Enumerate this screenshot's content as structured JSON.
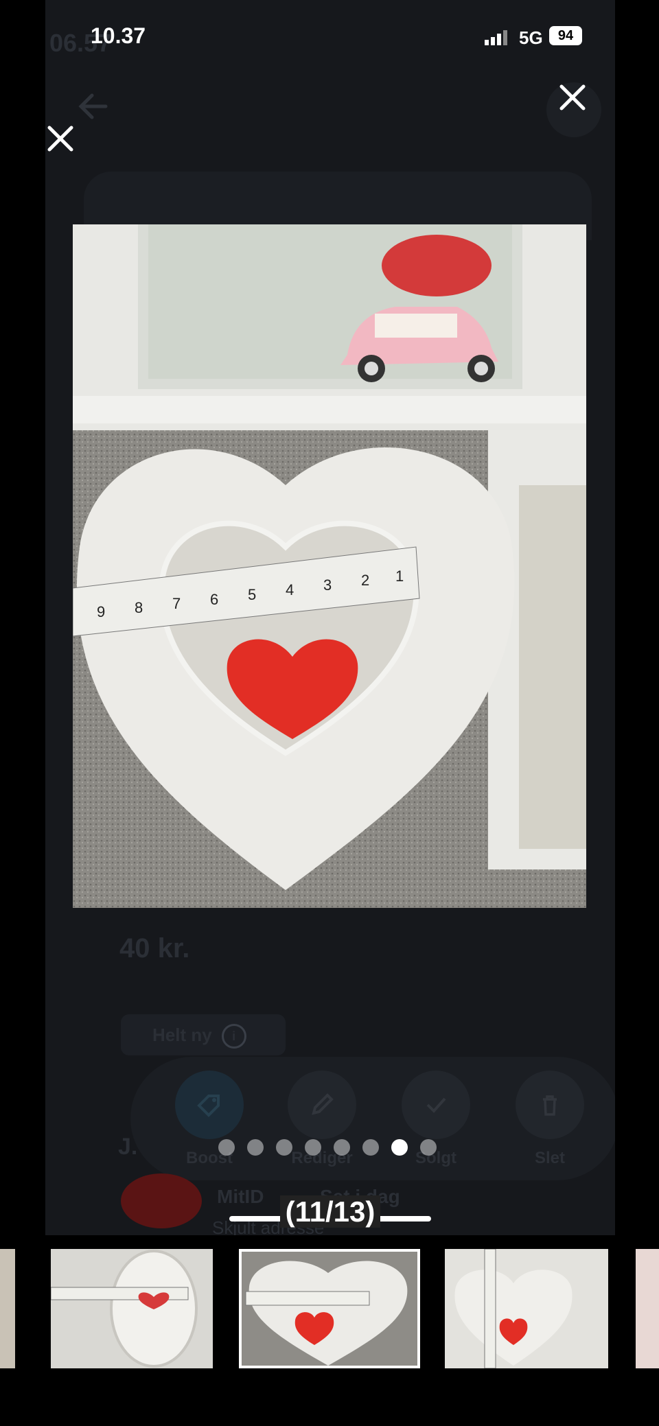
{
  "status_bar": {
    "time": "10.37",
    "network": "5G",
    "battery": "94"
  },
  "background_app": {
    "status_time": "06.57",
    "price": "40 kr.",
    "condition_chip": "Helt ny",
    "info_icon": "info-icon",
    "actions": [
      {
        "label": "Boost",
        "icon": "tag-icon"
      },
      {
        "label": "Rediger",
        "icon": "pencil-icon"
      },
      {
        "label": "Solgt",
        "icon": "check-icon"
      },
      {
        "label": "Slet",
        "icon": "trash-icon"
      }
    ],
    "seller_initial": "J.",
    "seller_badge": "MitID",
    "seller_status": "Set i dag",
    "address_note": "Skjult adresse"
  },
  "viewer": {
    "close_label": "close",
    "counter": "(11/13)",
    "page_dots": 8,
    "active_dot": 6
  },
  "colors": {
    "pink": "#f96b6b",
    "white": "#ffffff",
    "dim_bg": "#16181c"
  }
}
